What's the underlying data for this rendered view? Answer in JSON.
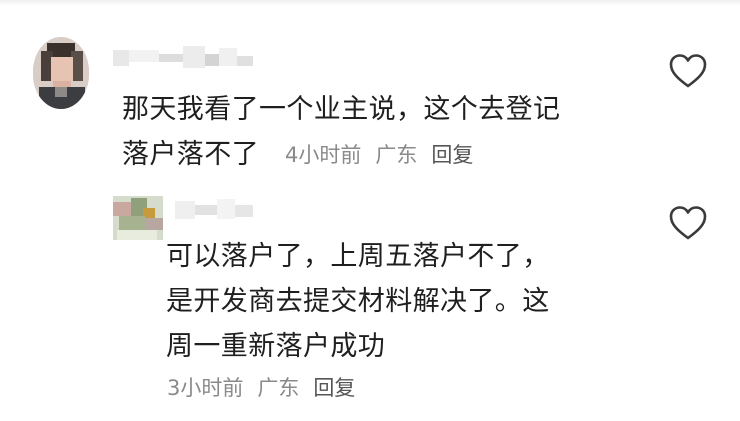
{
  "comments": [
    {
      "text_line1": "那天我看了一个业主说，这个去登记",
      "text_line2": "落户落不了",
      "time": "4小时前",
      "location": "广东",
      "reply": "回复",
      "like_icon": "heart-outline-icon"
    },
    {
      "text_line1": "可以落户了，上周五落户不了，",
      "text_line2": "是开发商去提交材料解决了。这",
      "text_line3": "周一重新落户成功",
      "time": "3小时前",
      "location": "广东",
      "reply": "回复",
      "like_icon": "heart-outline-icon"
    }
  ]
}
